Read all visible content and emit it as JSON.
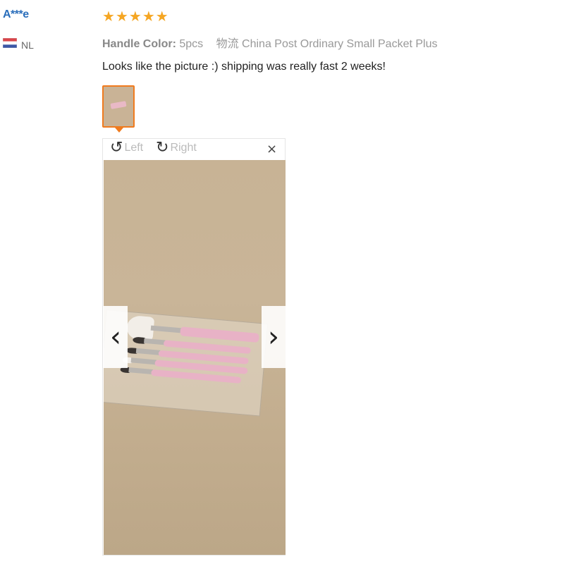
{
  "reviewer": {
    "name": "A***e",
    "country": "NL",
    "flag_icon": "netherlands-flag-icon"
  },
  "review": {
    "rating": 5,
    "stars": [
      "★",
      "★",
      "★",
      "★",
      "★"
    ],
    "attribute_label": "Handle Color:",
    "attribute_value": "5pcs",
    "logistics_text": "物流 China Post Ordinary Small Packet Plus",
    "text": "Looks like the picture :) shipping was really fast 2 weeks!"
  },
  "viewer": {
    "rotate_left_label": "Left",
    "rotate_right_label": "Right",
    "rotate_left_icon": "↺",
    "rotate_right_icon": "↻",
    "close_icon": "×",
    "prev_icon": "‹",
    "next_icon": "›"
  },
  "colors": {
    "accent": "#f07b1e",
    "star": "#f5a623",
    "name": "#2a6ebb"
  }
}
